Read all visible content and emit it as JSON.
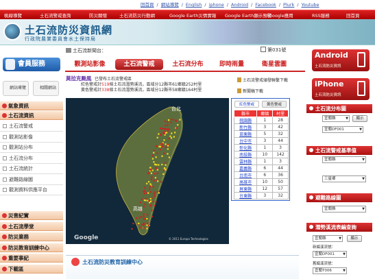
{
  "toplinks": [
    "回首頁",
    "網站導覽",
    "English",
    "iphone",
    "Android",
    "Facebook",
    "Plurk",
    "Youtube"
  ],
  "nav": [
    "桃線導覽",
    "土石流警戒查詢",
    "防災關懷",
    "土石流防災行動網",
    "Google Earth災情實報",
    "Google Earth顯示預警",
    "iGoogle應用",
    "RSS服務",
    "回首頁"
  ],
  "site": {
    "title": "土石流防災資訊網",
    "subtitle": "行政院農業委員會水土保持局"
  },
  "breadcrumb": "土石流新聞台：",
  "counter": "第031號",
  "sidebar": {
    "member": "會員服務",
    "mini": [
      "網站導覽",
      "相關網站"
    ],
    "sections": [
      {
        "label": "氣象資訊"
      },
      {
        "label": "土石流資訊"
      }
    ],
    "items": [
      "土石流警戒",
      "觀測站影像",
      "觀測站分布",
      "土石流分布",
      "土石流統計",
      "避難路線圖",
      "觀測資料供應平台"
    ],
    "sections2": [
      "災害紀實",
      "土石流學堂",
      "防災業務",
      "防災教育訓練中心",
      "重要事紀",
      "下載區"
    ]
  },
  "tabs": [
    "觀測站影像",
    "土石流警戒",
    "土石流分布",
    "即時雨量",
    "衛星雲圖"
  ],
  "alert": {
    "title": "莫拉克颱風",
    "subtitle": "已發布土石流警戒區",
    "line1_a": "紅色警戒計",
    "line1_n": "519",
    "line1_b": "條土石流潛勢溪流，區域分12縣市61鄉鎮252村里",
    "line2_a": "黃色警戒計",
    "line2_n": "338",
    "line2_b": "條土石流潛勢溪流，區域分12縣市58鄉鎮164村里"
  },
  "doclinks": [
    "土石流警戒頒發聯繫下載",
    "新聞稿下載"
  ],
  "map": {
    "label_north": "台北",
    "label_south": "高雄",
    "watermark": "Google",
    "credit": "© 2011 Europa Technologies"
  },
  "table": {
    "tabs": [
      "紅色警戒",
      "黃色警戒"
    ],
    "headers": [
      "縣市",
      "鄉鎮",
      "村里"
    ],
    "rows": [
      [
        "桃園縣",
        "1",
        "28"
      ],
      [
        "新竹縣",
        "3",
        "42"
      ],
      [
        "苗栗縣",
        "5",
        "32"
      ],
      [
        "台中市",
        "3",
        "44"
      ],
      [
        "彰化縣",
        "1",
        "3"
      ],
      [
        "南投縣",
        "10",
        "142"
      ],
      [
        "雲林縣",
        "1",
        "3"
      ],
      [
        "嘉義縣",
        "6",
        "44"
      ],
      [
        "台南市",
        "6",
        "36"
      ],
      [
        "高雄市",
        "10",
        "50"
      ],
      [
        "屏東縣",
        "12",
        "57"
      ],
      [
        "台東縣",
        "3",
        "32"
      ]
    ]
  },
  "course": "土石流防災教育訓練中心",
  "right": {
    "android": {
      "big": "Android",
      "small": "土石流防災資訊"
    },
    "iphone": {
      "big": "iPhone",
      "small": "土石流防災資訊"
    },
    "sec1": {
      "title": "土石流分布圖",
      "sel1": "宜蘭縣",
      "btn": "顯示",
      "sel2": "宜蘭DF001"
    },
    "sec2": {
      "title": "土石流警戒基準值",
      "sel1": "宜蘭縣",
      "sel2": "三星鄉"
    },
    "sec3": {
      "title": "避難路線圖",
      "sel1": "宜蘭縣"
    },
    "sec4": {
      "title": "潛勢溪流表編查詢",
      "sel1": "宜蘭縣",
      "btn": "顯示",
      "label1": "新編溪流號：",
      "sel2": "宜蘭DF001",
      "label2": "舊編溪流號：",
      "sel3": "宜蘭T006"
    }
  },
  "colors": {
    "red": "#cc2222",
    "blue": "#2244cc",
    "yellow": "#eedd22"
  }
}
